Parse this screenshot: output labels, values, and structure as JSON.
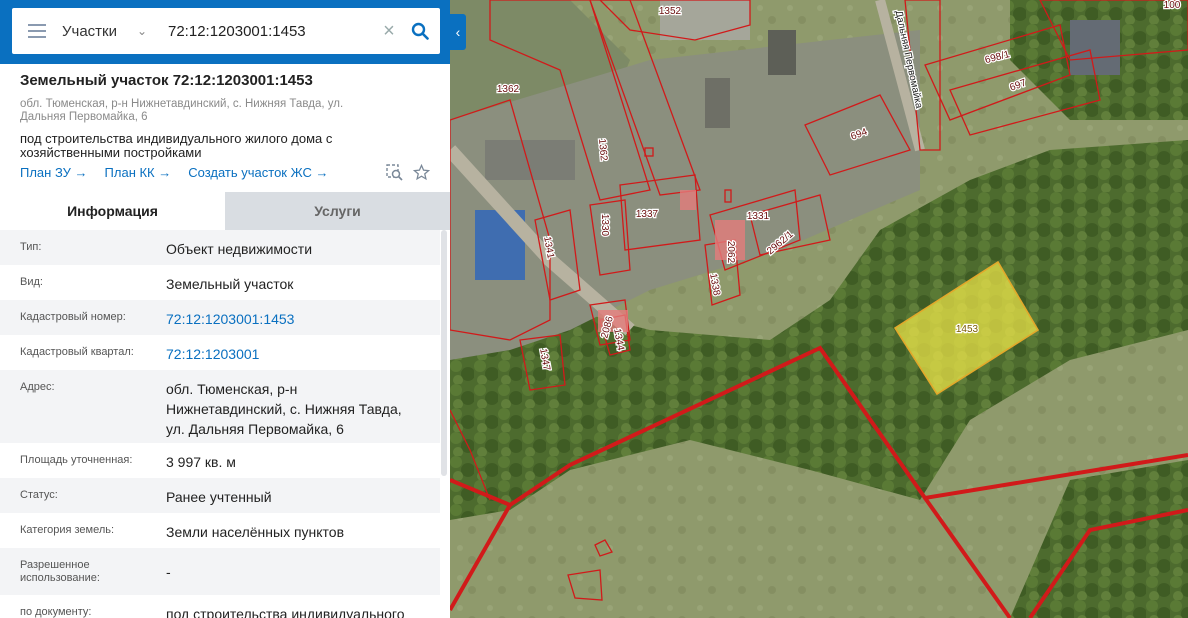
{
  "search": {
    "layer": "Участки",
    "query": "72:12:1203001:1453"
  },
  "object": {
    "title": "Земельный участок 72:12:1203001:1453",
    "address": "обл. Тюменская, р-н Нижнетавдинский, с. Нижняя Тавда, ул. Дальняя Первомайка, 6",
    "purpose": "под строительства индивидуального жилого дома с хозяйственными постройками",
    "links": [
      "План ЗУ →",
      "План КК →",
      "Создать участок ЖС →"
    ]
  },
  "tabs": [
    "Информация",
    "Услуги"
  ],
  "info_rows": [
    {
      "label": "Тип:",
      "value": "Объект недвижимости",
      "link": false
    },
    {
      "label": "Вид:",
      "value": "Земельный участок",
      "link": false
    },
    {
      "label": "Кадастровый номер:",
      "value": "72:12:1203001:1453",
      "link": true
    },
    {
      "label": "Кадастровый квартал:",
      "value": "72:12:1203001",
      "link": true
    },
    {
      "label": "Адрес:",
      "value": "обл. Тюменская, р-н Нижнетавдинский, с. Нижняя Тавда, ул. Дальняя Первомайка, 6",
      "link": false
    },
    {
      "label": "Площадь уточненная:",
      "value": "3 997 кв. м",
      "link": false
    },
    {
      "label": "Статус:",
      "value": "Ранее учтенный",
      "link": false
    },
    {
      "label": "Категория земель:",
      "value": "Земли населённых пунктов",
      "link": false
    },
    {
      "label": "Разрешенное использование:",
      "value": "-",
      "link": false
    },
    {
      "label": "по документу:",
      "value": "под строительства индивидуального",
      "link": false
    }
  ],
  "map": {
    "street_label": "Дальняя Первомайка",
    "parcel_labels": [
      "1352",
      "100",
      "698/1",
      "697",
      "1362",
      "1362",
      "694",
      "1337",
      "1331",
      "1330",
      "1341",
      "2062",
      "2962/1",
      "1338",
      "2086",
      "1344",
      "1347",
      "1453"
    ],
    "highlight_parcel": "1453",
    "colors": {
      "parcel_border": "#d11a1a",
      "highlight_fill": "#f0e84a",
      "panel_accent": "#0a70c0"
    }
  },
  "icons": [
    "menu-icon",
    "chevron-down-icon",
    "clear-icon",
    "search-icon",
    "collapse-icon",
    "zoom-to-icon",
    "star-icon"
  ]
}
